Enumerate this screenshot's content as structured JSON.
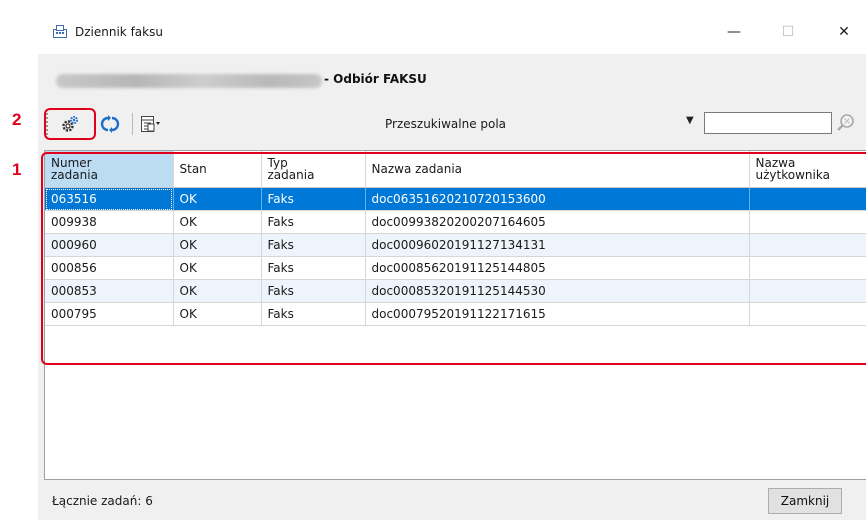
{
  "callouts": {
    "one": "1",
    "two": "2"
  },
  "window": {
    "title": "Dziennik faksu",
    "minimize": "—",
    "maximize": "☐",
    "close": "✕"
  },
  "subject": {
    "suffix": "- Odbiór FAKSU"
  },
  "toolbar": {
    "search_fields_label": "Przeszukiwalne pola",
    "search_value": "",
    "icons": [
      "settings-gear-icon",
      "refresh-icon",
      "column-view-icon",
      "search-magnifier-icon"
    ]
  },
  "table": {
    "headers": {
      "job_number": "Numer\nzadania",
      "status": "Stan",
      "job_type": "Typ\nzadania",
      "job_name": "Nazwa zadania",
      "user_name": "Nazwa\nużytkownika"
    },
    "rows": [
      {
        "job_number": "063516",
        "status": "OK",
        "job_type": "Faks",
        "job_name": "doc06351620210720153600",
        "user_name": ""
      },
      {
        "job_number": "009938",
        "status": "OK",
        "job_type": "Faks",
        "job_name": "doc00993820200207164605",
        "user_name": ""
      },
      {
        "job_number": "000960",
        "status": "OK",
        "job_type": "Faks",
        "job_name": "doc00096020191127134131",
        "user_name": ""
      },
      {
        "job_number": "000856",
        "status": "OK",
        "job_type": "Faks",
        "job_name": "doc00085620191125144805",
        "user_name": ""
      },
      {
        "job_number": "000853",
        "status": "OK",
        "job_type": "Faks",
        "job_name": "doc00085320191125144530",
        "user_name": ""
      },
      {
        "job_number": "000795",
        "status": "OK",
        "job_type": "Faks",
        "job_name": "doc00079520191122171615",
        "user_name": ""
      }
    ],
    "selected_row": 0
  },
  "status": {
    "total_label": "Łącznie zadań: 6",
    "close_button": "Zamknij"
  },
  "colors": {
    "callout": "#e0001b",
    "selection": "#0078d7",
    "sorted_header": "#bcdcf4",
    "alt_row": "#eef4fc"
  }
}
